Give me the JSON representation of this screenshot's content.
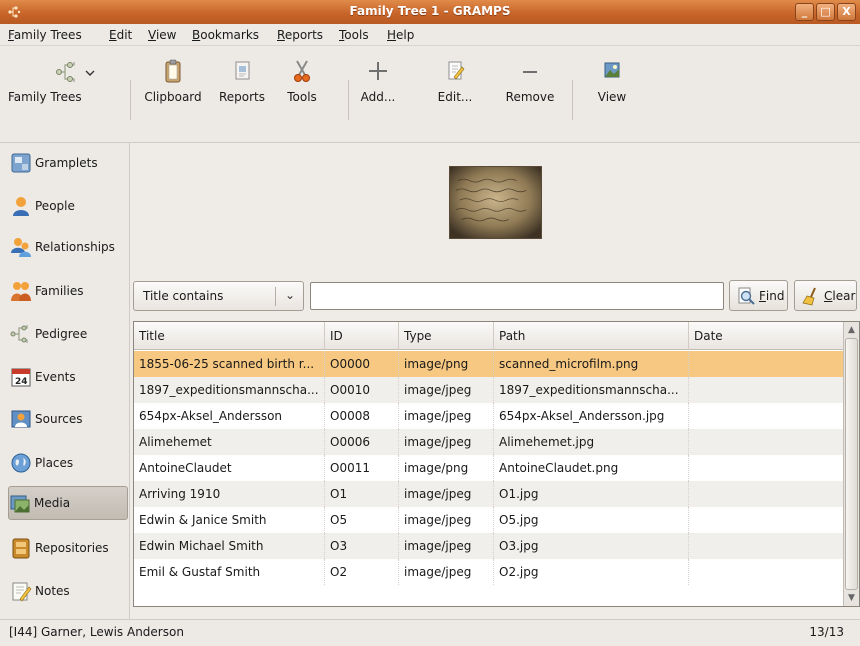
{
  "window": {
    "title": "Family Tree 1 - GRAMPS",
    "controls": [
      "_",
      "□",
      "X"
    ]
  },
  "menu": [
    {
      "label": "Family Trees",
      "mnemonic": "F",
      "rest": "amily Trees"
    },
    {
      "label": "Edit",
      "mnemonic": "E",
      "rest": "dit"
    },
    {
      "label": "View",
      "mnemonic": "V",
      "rest": "iew"
    },
    {
      "label": "Bookmarks",
      "mnemonic": "B",
      "rest": "ookmarks"
    },
    {
      "label": "Reports",
      "mnemonic": "R",
      "rest": "eports"
    },
    {
      "label": "Tools",
      "mnemonic": "T",
      "rest": "ools"
    },
    {
      "label": "Help",
      "mnemonic": "H",
      "rest": "elp"
    }
  ],
  "toolbar": {
    "family_trees": "Family Trees",
    "clipboard": "Clipboard",
    "reports": "Reports",
    "tools": "Tools",
    "add": "Add...",
    "edit": "Edit...",
    "remove": "Remove",
    "view": "View"
  },
  "sidebar": {
    "items": [
      {
        "label": "Gramplets",
        "icon": "gramplets-icon"
      },
      {
        "label": "People",
        "icon": "person-icon"
      },
      {
        "label": "Relationships",
        "icon": "relationships-icon"
      },
      {
        "label": "Families",
        "icon": "families-icon"
      },
      {
        "label": "Pedigree",
        "icon": "pedigree-icon"
      },
      {
        "label": "Events",
        "icon": "events-icon"
      },
      {
        "label": "Sources",
        "icon": "sources-icon"
      },
      {
        "label": "Places",
        "icon": "places-icon"
      },
      {
        "label": "Media",
        "icon": "media-icon"
      },
      {
        "label": "Repositories",
        "icon": "repositories-icon"
      },
      {
        "label": "Notes",
        "icon": "notes-icon"
      }
    ],
    "active": "Media"
  },
  "filter": {
    "field": "Title contains",
    "value": "",
    "find_mnemonic": "F",
    "find_rest": "ind",
    "clear_mnemonic": "C",
    "clear_rest": "lear"
  },
  "table": {
    "columns": [
      "Title",
      "ID",
      "Type",
      "Path",
      "Date"
    ],
    "rows": [
      [
        "1855-06-25 scanned birth r...",
        "O0000",
        "image/png",
        "scanned_microfilm.png",
        ""
      ],
      [
        "1897_expeditionsmannscha...",
        "O0010",
        "image/jpeg",
        "1897_expeditionsmannscha...",
        ""
      ],
      [
        "654px-Aksel_Andersson",
        "O0008",
        "image/jpeg",
        "654px-Aksel_Andersson.jpg",
        ""
      ],
      [
        "Alimehemet",
        "O0006",
        "image/jpeg",
        "Alimehemet.jpg",
        ""
      ],
      [
        "AntoineClaudet",
        "O0011",
        "image/png",
        "AntoineClaudet.png",
        ""
      ],
      [
        "Arriving 1910",
        "O1",
        "image/jpeg",
        "O1.jpg",
        ""
      ],
      [
        "Edwin & Janice Smith",
        "O5",
        "image/jpeg",
        "O5.jpg",
        ""
      ],
      [
        "Edwin Michael Smith",
        "O3",
        "image/jpeg",
        "O3.jpg",
        ""
      ],
      [
        "Emil & Gustaf Smith",
        "O2",
        "image/jpeg",
        "O2.jpg",
        ""
      ]
    ],
    "selected_index": 0
  },
  "status": {
    "text": "[I44] Garner, Lewis Anderson",
    "count": "13/13"
  },
  "colors": {
    "titlebar": "#c8652a",
    "selection": "#f7c881"
  }
}
